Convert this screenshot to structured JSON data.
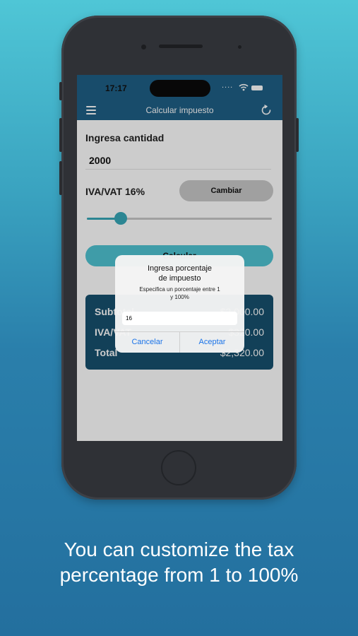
{
  "status_bar": {
    "time": "17:17",
    "signal": "....",
    "wifi": "wifi-icon",
    "battery": "battery-icon"
  },
  "navbar": {
    "title": "Calcular impuesto",
    "menu_icon": "menu-icon",
    "refresh_icon": "refresh-icon"
  },
  "form": {
    "amount_label": "Ingresa cantidad",
    "amount_value": "2000",
    "vat_label": "IVA/VAT 16%",
    "change_button": "Cambiar",
    "slider_value_percent": 16,
    "calculate_button": "Calcular"
  },
  "results": {
    "rows": [
      {
        "label": "Subtotal",
        "value": "$2,000.00"
      },
      {
        "label": "IVA/VAT",
        "value": "$320.00"
      },
      {
        "label": "Total",
        "value": "$2,320.00"
      }
    ]
  },
  "dialog": {
    "title_line1": "Ingresa porcentaje",
    "title_line2": "de impuesto",
    "message_line1": "Especifica un porcentaje entre 1",
    "message_line2": "y 100%",
    "input_value": "16",
    "cancel_label": "Cancelar",
    "accept_label": "Aceptar"
  },
  "caption": {
    "line1": "You can customize the tax",
    "line2": "percentage from 1 to 100%"
  },
  "colors": {
    "nav": "#1f5f86",
    "accent": "#38a8b8",
    "results_bg": "#17506f",
    "dialog_button": "#1a73e8"
  }
}
